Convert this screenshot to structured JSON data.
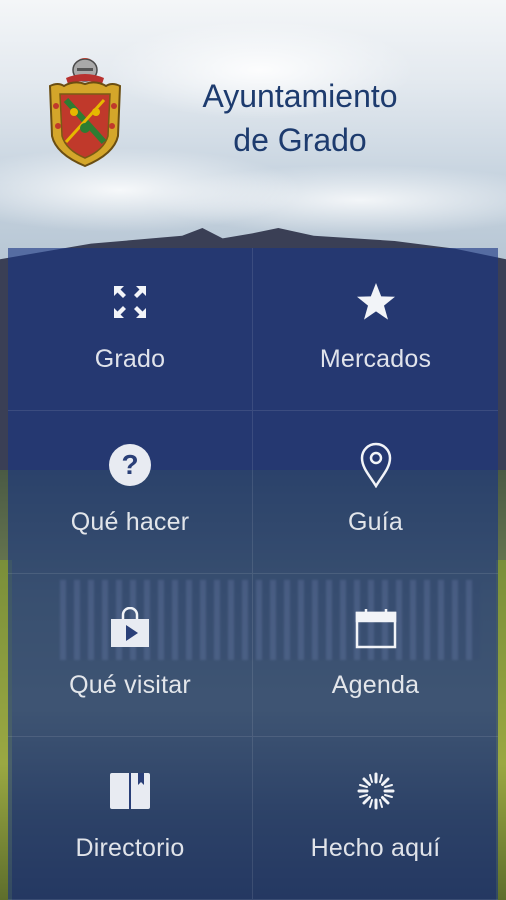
{
  "header": {
    "title_line1": "Ayuntamiento",
    "title_line2": "de Grado"
  },
  "menu": [
    {
      "label": "Grado",
      "icon": "expand-arrows-icon"
    },
    {
      "label": "Mercados",
      "icon": "star-icon"
    },
    {
      "label": "Qué hacer",
      "icon": "question-circle-icon"
    },
    {
      "label": "Guía",
      "icon": "map-pin-icon"
    },
    {
      "label": "Qué visitar",
      "icon": "shopping-bag-play-icon"
    },
    {
      "label": "Agenda",
      "icon": "calendar-icon"
    },
    {
      "label": "Directorio",
      "icon": "book-icon"
    },
    {
      "label": "Hecho aquí",
      "icon": "spinner-icon"
    }
  ],
  "colors": {
    "title": "#1d3b6e",
    "panel_overlay": "#18348a",
    "icon_color": "#ffffff"
  }
}
